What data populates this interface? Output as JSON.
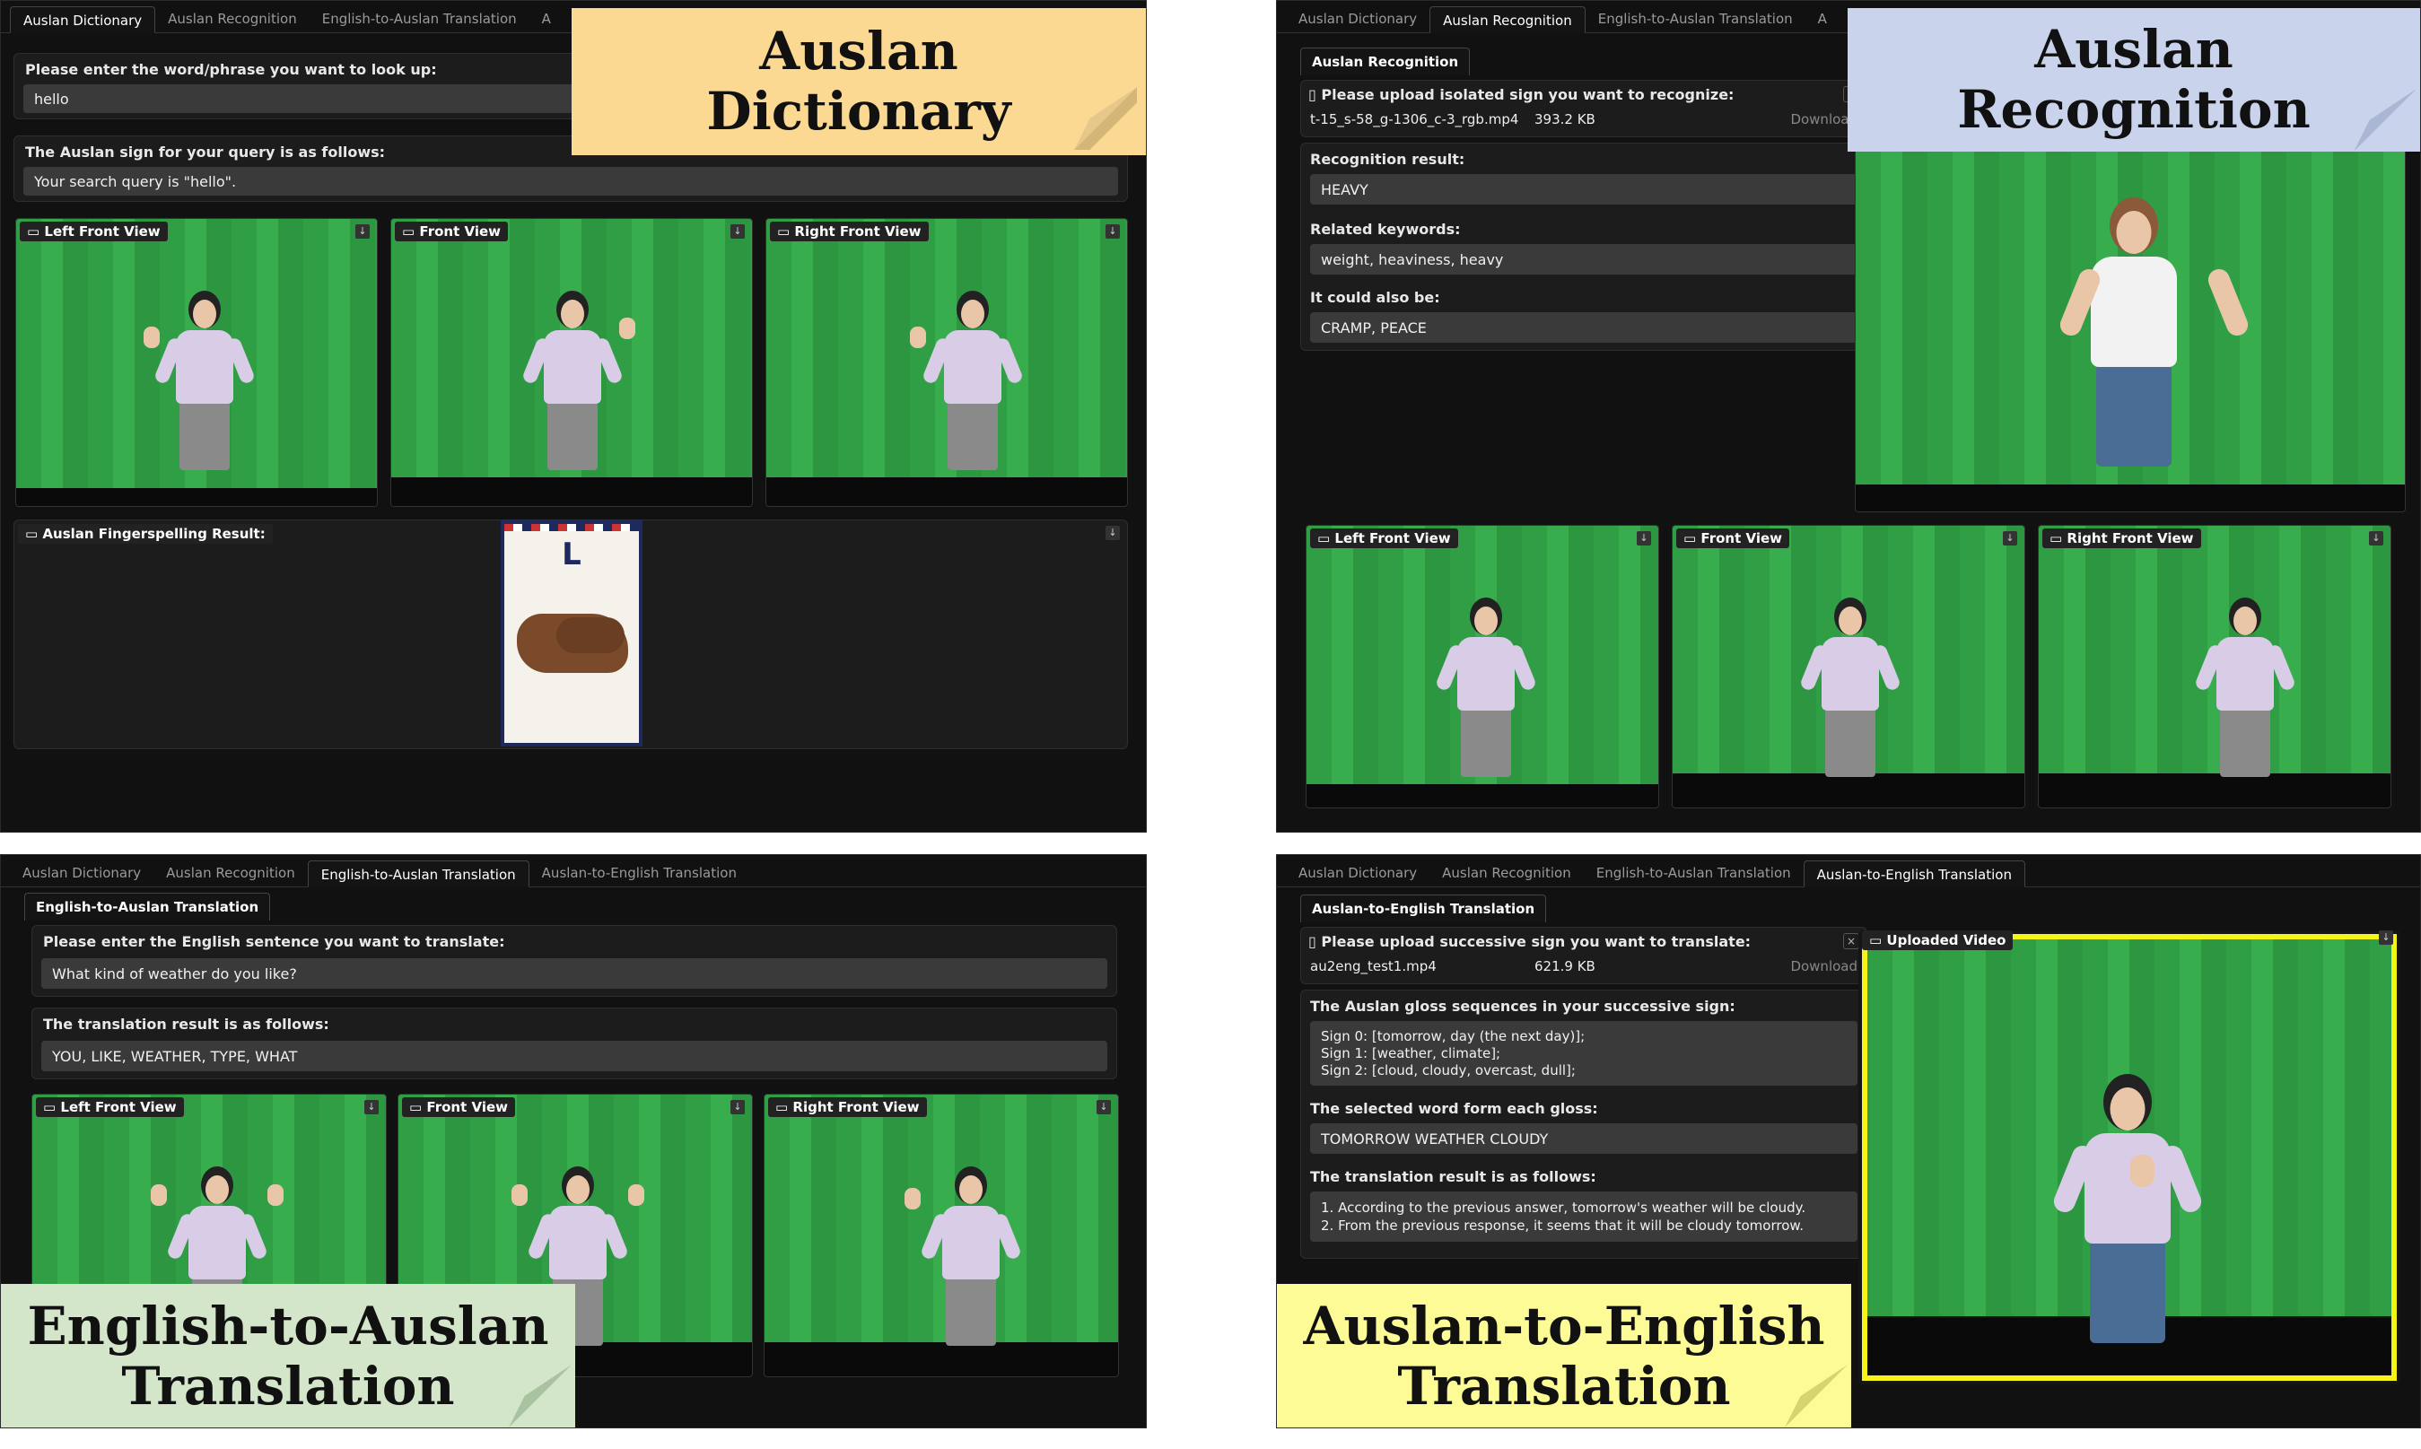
{
  "tabs": {
    "dictionary": "Auslan Dictionary",
    "recognition": "Auslan Recognition",
    "e2a": "English-to-Auslan Translation",
    "e2a_truncated": "A",
    "a2e": "Auslan-to-English Translation",
    "a2e_truncated": "A"
  },
  "dictionary": {
    "query_label": "Please enter the word/phrase you want to look up:",
    "query_value": "hello",
    "result_label": "The Auslan sign for your query is as follows:",
    "result_value": "Your search query is \"hello\".",
    "views": [
      "Left Front View",
      "Front View",
      "Right Front View"
    ],
    "fingerspelling_label": "Auslan Fingerspelling Result:",
    "card_letter": "L",
    "callout_line1": "Auslan",
    "callout_line2": "Dictionary"
  },
  "recognition": {
    "subtab": "Auslan Recognition",
    "upload_label": "Please upload isolated sign you want to recognize:",
    "file_name": "t-15_s-58_g-1306_c-3_rgb.mp4",
    "file_size": "393.2 KB",
    "download": "Download",
    "result_label": "Recognition result:",
    "result_value": "HEAVY",
    "keywords_label": "Related keywords:",
    "keywords_value": "weight, heaviness, heavy",
    "also_label": "It could also be:",
    "also_value": "CRAMP, PEACE",
    "views": [
      "Left Front View",
      "Front View",
      "Right Front View"
    ],
    "callout_line1": "Auslan",
    "callout_line2": "Recognition"
  },
  "e2a": {
    "subtab": "English-to-Auslan Translation",
    "input_label": "Please enter the English sentence you want to translate:",
    "input_value": "What kind of weather do you like?",
    "result_label": "The translation result is as follows:",
    "result_value": "YOU, LIKE, WEATHER, TYPE, WHAT",
    "views": [
      "Left Front View",
      "Front View",
      "Right Front View"
    ],
    "callout_line1": "English-to-Auslan",
    "callout_line2": "Translation"
  },
  "a2e": {
    "subtab": "Auslan-to-English Translation",
    "upload_label": "Please upload successive sign you want to translate:",
    "file_name": "au2eng_test1.mp4",
    "file_size": "621.9 KB",
    "download": "Download",
    "uploaded_video": "Uploaded Video",
    "gloss_label": "The Auslan gloss sequences in your successive sign:",
    "gloss_lines": [
      "Sign 0: [tomorrow,   day (the next day)];",
      "Sign 1: [weather,   climate];",
      "Sign 2: [cloud, cloudy, overcast, dull];"
    ],
    "selected_label": "The selected word form each gloss:",
    "selected_value": "TOMORROW WEATHER CLOUDY",
    "result_label": "The translation result is as follows:",
    "result_lines": [
      "1. According to the previous answer, tomorrow's weather will be cloudy.",
      "2. From the previous response, it seems that it will be cloudy tomorrow."
    ],
    "callout_line1": "Auslan-to-English",
    "callout_line2": "Translation"
  },
  "colors": {
    "dictionary_callout": "#fcd993",
    "recognition_callout": "#c9d4ec",
    "e2a_callout": "#d4e6c9",
    "a2e_callout": "#fdfb96",
    "uploaded_border": "#f5f518"
  },
  "icons": [
    "camera-icon",
    "download-icon",
    "file-icon",
    "close-icon"
  ]
}
